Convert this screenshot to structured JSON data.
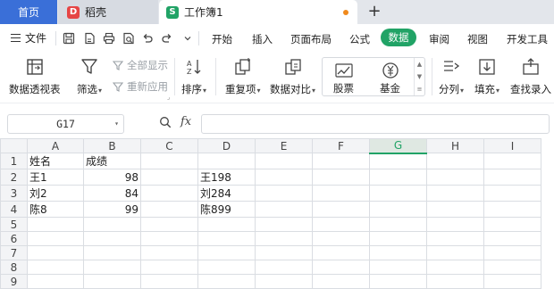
{
  "tabs": {
    "home": "首页",
    "daoke": "稻壳",
    "workbook": "工作簿1",
    "daoke_badge": "D",
    "workbook_badge": "S",
    "add": "+"
  },
  "menu": {
    "file": "文件",
    "tabs": [
      "开始",
      "插入",
      "页面布局",
      "公式",
      "数据",
      "审阅",
      "视图",
      "开发工具"
    ],
    "active": "数据"
  },
  "ribbon": {
    "pivot": "数据透视表",
    "filter": "筛选",
    "show_all": "全部显示",
    "reapply": "重新应用",
    "sort": "排序",
    "duplicates": "重复项",
    "compare": "数据对比",
    "stocks": "股票",
    "funds": "基金",
    "split": "分列",
    "fill": "填充",
    "find_entry": "查找录入"
  },
  "formula_bar": {
    "cell_ref": "G17",
    "fx": "fx",
    "formula": ""
  },
  "sheet": {
    "columns": [
      "A",
      "B",
      "C",
      "D",
      "E",
      "F",
      "G",
      "H",
      "I"
    ],
    "active_column": "G",
    "rows": [
      {
        "n": "1",
        "cells": [
          "姓名",
          "成绩",
          "",
          "",
          "",
          "",
          "",
          "",
          ""
        ]
      },
      {
        "n": "2",
        "cells": [
          "王1",
          "98",
          "",
          "王198",
          "",
          "",
          "",
          "",
          ""
        ]
      },
      {
        "n": "3",
        "cells": [
          "刘2",
          "84",
          "",
          "刘284",
          "",
          "",
          "",
          "",
          ""
        ]
      },
      {
        "n": "4",
        "cells": [
          "陈8",
          "99",
          "",
          "陈899",
          "",
          "",
          "",
          "",
          ""
        ]
      },
      {
        "n": "5",
        "cells": [
          "",
          "",
          "",
          "",
          "",
          "",
          "",
          "",
          ""
        ]
      },
      {
        "n": "6",
        "cells": [
          "",
          "",
          "",
          "",
          "",
          "",
          "",
          "",
          ""
        ]
      },
      {
        "n": "7",
        "cells": [
          "",
          "",
          "",
          "",
          "",
          "",
          "",
          "",
          ""
        ]
      },
      {
        "n": "8",
        "cells": [
          "",
          "",
          "",
          "",
          "",
          "",
          "",
          "",
          ""
        ]
      },
      {
        "n": "9",
        "cells": [
          "",
          "",
          "",
          "",
          "",
          "",
          "",
          "",
          ""
        ]
      }
    ]
  },
  "colors": {
    "accent": "#21a366",
    "home_tab": "#3a6fd8",
    "unsaved_dot": "#f08a1c"
  }
}
